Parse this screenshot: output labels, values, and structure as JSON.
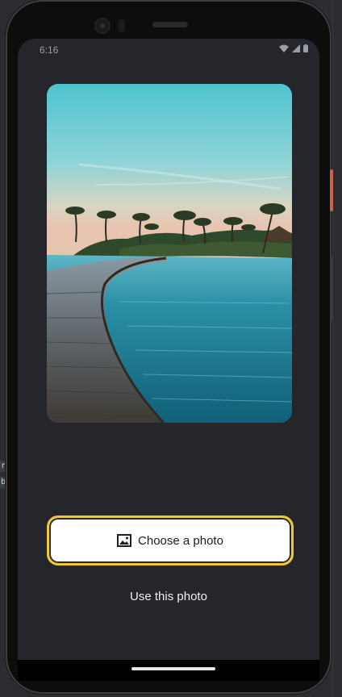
{
  "status_bar": {
    "time": "6:16",
    "icons": [
      "wifi-icon",
      "cellular-icon",
      "battery-icon"
    ]
  },
  "photo": {
    "description_icon": "beach-boardwalk-photo"
  },
  "actions": {
    "choose_label": "Choose a photo",
    "choose_icon": "image-icon",
    "use_label": "Use this photo"
  },
  "side_panel": {
    "chip_1": "r",
    "chip_2": "b"
  },
  "colors": {
    "screen_bg": "#24262b",
    "accent_border": "#f0c82e",
    "button_bg": "#ffffff"
  }
}
